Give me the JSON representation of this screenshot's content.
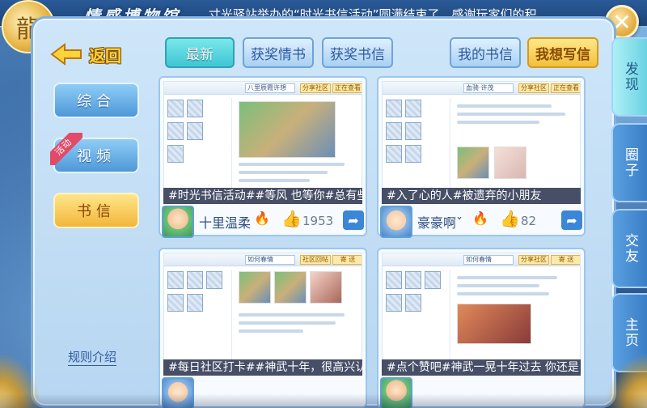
{
  "header": {
    "title": "情感博物馆",
    "marquee": "寸光驿站举办的“时光书信活动”圆满结束了，感谢玩家们的积"
  },
  "nav": {
    "back_label": "返回"
  },
  "tabs": [
    {
      "label": "最新",
      "active": true
    },
    {
      "label": "获奖情书",
      "active": false
    },
    {
      "label": "获奖书信",
      "active": false
    },
    {
      "label": "我的书信",
      "active": false
    },
    {
      "label": "我想写信",
      "active": false
    }
  ],
  "left_menu": [
    {
      "label": "综合",
      "active": false,
      "ribbon": ""
    },
    {
      "label": "视频",
      "active": false,
      "ribbon": "活动"
    },
    {
      "label": "书信",
      "active": true,
      "ribbon": ""
    }
  ],
  "rules_link": "规则介绍",
  "right_tabs": [
    {
      "label": "发现",
      "active": true
    },
    {
      "label": "圈子",
      "active": false
    },
    {
      "label": "交友",
      "active": false
    },
    {
      "label": "主页",
      "active": false
    }
  ],
  "cards": [
    {
      "hashtag": "#时光书信活动##等风 也等你#总有些",
      "user": "十里温柔",
      "likes": "1953",
      "bar_title": "八里辰霞许想",
      "bar_btn_a": "分享社区",
      "bar_btn_b": "正在查看"
    },
    {
      "hashtag": "#入了心的人#被遗弃的小朋友",
      "user": "豪豪啊ˇ",
      "likes": "82",
      "bar_title": "血骑·许茂",
      "bar_btn_a": "分享社区",
      "bar_btn_b": "正在查看"
    },
    {
      "hashtag": "#每日社区打卡##神武十年，很高兴认",
      "user": "",
      "likes": "",
      "bar_title": "如何春情",
      "bar_btn_a": "社区回帖",
      "bar_btn_b": "寄 送"
    },
    {
      "hashtag": "#点个赞吧#神武一晃十年过去 你还是",
      "user": "",
      "likes": "",
      "bar_title": "如何春情",
      "bar_btn_a": "分享社区",
      "bar_btn_b": "寄 送"
    }
  ],
  "colors": {
    "accent_teal": "#3fc6d4",
    "accent_gold": "#f2bf3a",
    "panel_bg": "#cfe6f9"
  }
}
